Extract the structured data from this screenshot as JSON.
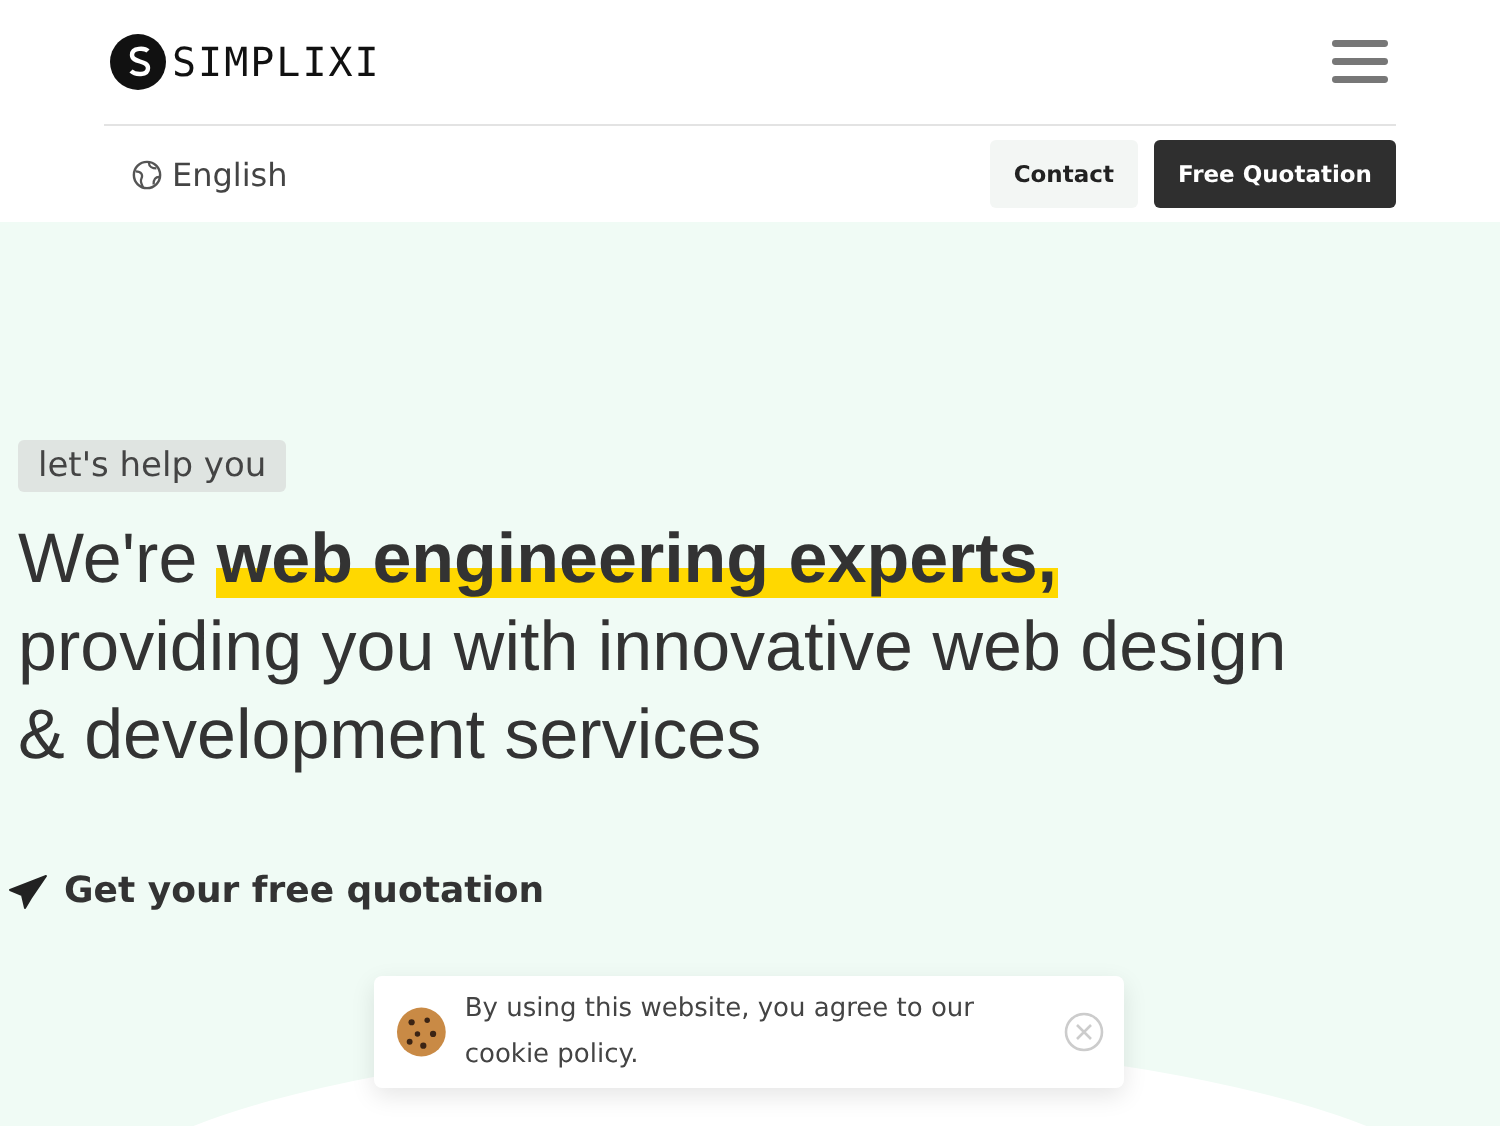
{
  "header": {
    "logo_text": "SIMPLIXI",
    "language": "English",
    "buttons": [
      {
        "label": "Contact",
        "kind": "light"
      },
      {
        "label": "Free Quotation",
        "kind": "dark"
      }
    ]
  },
  "hero": {
    "tag": "let's help you",
    "headline": "We're **web engineering experts,** providing you with innovative web design & development services",
    "cta": "Get your free quotation"
  },
  "cookie_banner": {
    "text": "By using this website, you agree to our cookie policy."
  }
}
